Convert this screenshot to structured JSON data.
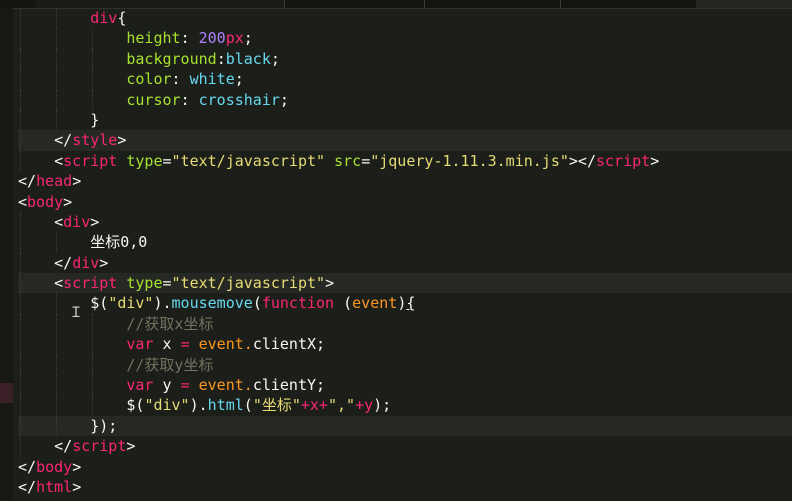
{
  "code_lines": [
    [
      {
        "t": "        "
      },
      {
        "t": "div",
        "c": "t"
      },
      {
        "t": "{",
        "c": "w"
      }
    ],
    [
      {
        "t": "            "
      },
      {
        "t": "height",
        "c": "a"
      },
      {
        "t": ": ",
        "c": "w"
      },
      {
        "t": "200",
        "c": "n"
      },
      {
        "t": "px",
        "c": "k"
      },
      {
        "t": ";",
        "c": "w"
      }
    ],
    [
      {
        "t": "            "
      },
      {
        "t": "background",
        "c": "a"
      },
      {
        "t": ":",
        "c": "w"
      },
      {
        "t": "black",
        "c": "f"
      },
      {
        "t": ";",
        "c": "w"
      }
    ],
    [
      {
        "t": "            "
      },
      {
        "t": "color",
        "c": "a"
      },
      {
        "t": ": ",
        "c": "w"
      },
      {
        "t": "white",
        "c": "f"
      },
      {
        "t": ";",
        "c": "w"
      }
    ],
    [
      {
        "t": "            "
      },
      {
        "t": "cursor",
        "c": "a"
      },
      {
        "t": ": ",
        "c": "w"
      },
      {
        "t": "crosshair",
        "c": "f"
      },
      {
        "t": ";",
        "c": "w"
      }
    ],
    [
      {
        "t": "        "
      },
      {
        "t": "}",
        "c": "w"
      }
    ],
    [
      {
        "t": "    "
      },
      {
        "t": "</",
        "c": "w"
      },
      {
        "t": "style",
        "c": "t"
      },
      {
        "t": ">",
        "c": "w"
      }
    ],
    [
      {
        "t": "    "
      },
      {
        "t": "<",
        "c": "w"
      },
      {
        "t": "script",
        "c": "t"
      },
      {
        "t": " "
      },
      {
        "t": "type",
        "c": "a"
      },
      {
        "t": "=",
        "c": "w"
      },
      {
        "t": "\"text/javascript\"",
        "c": "s"
      },
      {
        "t": " "
      },
      {
        "t": "src",
        "c": "a"
      },
      {
        "t": "=",
        "c": "w"
      },
      {
        "t": "\"jquery-1.11.3.min.js\"",
        "c": "s"
      },
      {
        "t": "></",
        "c": "w"
      },
      {
        "t": "script",
        "c": "t"
      },
      {
        "t": ">",
        "c": "w"
      }
    ],
    [
      {
        "t": "</",
        "c": "w"
      },
      {
        "t": "head",
        "c": "t"
      },
      {
        "t": ">",
        "c": "w"
      }
    ],
    [
      {
        "t": "<",
        "c": "w"
      },
      {
        "t": "body",
        "c": "t"
      },
      {
        "t": ">",
        "c": "w"
      }
    ],
    [
      {
        "t": "    "
      },
      {
        "t": "<",
        "c": "w"
      },
      {
        "t": "div",
        "c": "t"
      },
      {
        "t": ">",
        "c": "w"
      }
    ],
    [
      {
        "t": "        "
      },
      {
        "t": "坐标0,0",
        "c": "w"
      }
    ],
    [
      {
        "t": "    "
      },
      {
        "t": "</",
        "c": "w"
      },
      {
        "t": "div",
        "c": "t"
      },
      {
        "t": ">",
        "c": "w"
      }
    ],
    [
      {
        "t": "    "
      },
      {
        "t": "<",
        "c": "w"
      },
      {
        "t": "script",
        "c": "t"
      },
      {
        "t": " "
      },
      {
        "t": "type",
        "c": "a"
      },
      {
        "t": "=",
        "c": "w"
      },
      {
        "t": "\"text/javascript\"",
        "c": "s"
      },
      {
        "t": ">",
        "c": "w"
      }
    ],
    [
      {
        "t": "        "
      },
      {
        "t": "$(",
        "c": "w"
      },
      {
        "t": "\"div\"",
        "c": "s"
      },
      {
        "t": ").",
        "c": "w"
      },
      {
        "t": "mousemove",
        "c": "f"
      },
      {
        "t": "(",
        "c": "w"
      },
      {
        "t": "function",
        "c": "k"
      },
      {
        "t": " ("
      },
      {
        "t": "event",
        "c": "p"
      },
      {
        "t": ")",
        "c": "w"
      },
      {
        "t": "{",
        "c": "u"
      }
    ],
    [
      {
        "t": "            "
      },
      {
        "t": "//获取x坐标",
        "c": "c"
      }
    ],
    [
      {
        "t": "            "
      },
      {
        "t": "var",
        "c": "k"
      },
      {
        "t": " x "
      },
      {
        "t": "=",
        "c": "k"
      },
      {
        "t": " event.",
        "c": "p"
      },
      {
        "t": "clientX;",
        "c": "w"
      }
    ],
    [
      {
        "t": "            "
      },
      {
        "t": "//获取y坐标",
        "c": "c"
      }
    ],
    [
      {
        "t": "            "
      },
      {
        "t": "var",
        "c": "k"
      },
      {
        "t": " y "
      },
      {
        "t": "=",
        "c": "k"
      },
      {
        "t": " event.",
        "c": "p"
      },
      {
        "t": "clientY;",
        "c": "w"
      }
    ],
    [
      {
        "t": "            "
      },
      {
        "t": "$(",
        "c": "w"
      },
      {
        "t": "\"div\"",
        "c": "s"
      },
      {
        "t": ").",
        "c": "w"
      },
      {
        "t": "html",
        "c": "f"
      },
      {
        "t": "(",
        "c": "w"
      },
      {
        "t": "\"坐标\"",
        "c": "s"
      },
      {
        "t": "+x+",
        "c": "k"
      },
      {
        "t": "\",\"",
        "c": "s"
      },
      {
        "t": "+y",
        "c": "k"
      },
      {
        "t": ");",
        "c": "w"
      }
    ],
    [
      {
        "t": "        "
      },
      {
        "t": "});",
        "c": "w"
      }
    ],
    [
      {
        "t": "    "
      },
      {
        "t": "</",
        "c": "w"
      },
      {
        "t": "script",
        "c": "t"
      },
      {
        "t": ">",
        "c": "w"
      }
    ],
    [
      {
        "t": "</",
        "c": "w"
      },
      {
        "t": "body",
        "c": "t"
      },
      {
        "t": ">",
        "c": "w"
      }
    ],
    [
      {
        "t": "</",
        "c": "w"
      },
      {
        "t": "html",
        "c": "t"
      },
      {
        "t": ">",
        "c": "w"
      }
    ]
  ],
  "highlighted_lines": [
    6,
    13,
    20
  ],
  "cursor_icon": "text-cursor-icon"
}
